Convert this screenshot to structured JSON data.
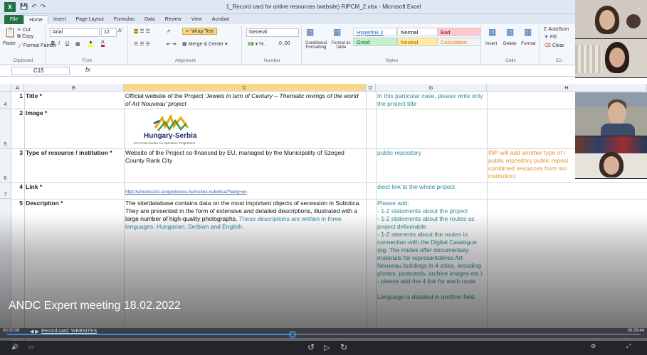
{
  "window": {
    "title": "1_Record card for online resources (website) RIPCM_2.xlsx - Microsoft Excel"
  },
  "ribbon_tabs": [
    "File",
    "Home",
    "Insert",
    "Page Layout",
    "Formulas",
    "Data",
    "Review",
    "View",
    "Acrobat"
  ],
  "ribbon": {
    "clipboard": {
      "paste": "Paste",
      "cut": "Cut",
      "copy": "Copy",
      "format_painter": "Format Painter",
      "label": "Clipboard"
    },
    "font": {
      "name": "Arial",
      "size": "12",
      "label": "Font"
    },
    "alignment": {
      "wrap_text": "Wrap Text",
      "merge_center": "Merge & Center",
      "label": "Alignment"
    },
    "number": {
      "format": "General",
      "label": "Number"
    },
    "styles": {
      "conditional": "Conditional Formatting",
      "format_table": "Format as Table",
      "cells": [
        {
          "name": "Hyperlink 2",
          "bg": "#ffffff",
          "fg": "#2a5db0"
        },
        {
          "name": "Normal",
          "bg": "#ffffff",
          "fg": "#000000"
        },
        {
          "name": "Bad",
          "bg": "#ffc7ce",
          "fg": "#9c0006"
        },
        {
          "name": "Good",
          "bg": "#c6efce",
          "fg": "#006100"
        },
        {
          "name": "Neutral",
          "bg": "#ffeb9c",
          "fg": "#9c6500"
        },
        {
          "name": "Calculation",
          "bg": "#f2f2f2",
          "fg": "#fa7d00"
        }
      ],
      "label": "Styles"
    },
    "cells": {
      "insert": "Insert",
      "delete": "Delete",
      "format": "Format",
      "label": "Cells"
    },
    "editing": {
      "autosum": "AutoSum",
      "fill": "Fill",
      "clear": "Clear",
      "label": "Ed"
    }
  },
  "formula_bar": {
    "cell_ref": "C15",
    "fx": "fx",
    "content": ""
  },
  "columns": [
    "A",
    "B",
    "C",
    "D",
    "G",
    "H"
  ],
  "rows": [
    {
      "num": "4",
      "a": "1",
      "b": "Title *",
      "c_text": "Official website of the Project ",
      "c_italic": "'Jewels in turn of Century – Thematic rovings of the world of Art Nouveau' project",
      "g": "In this particular case, please write only the project title",
      "h": ""
    },
    {
      "num": "5",
      "a": "2",
      "b": "Image *",
      "logo_title": "Hungary-Serbia",
      "logo_sub": "IPA Cross-border Co-operation Programme",
      "g": "",
      "h": ""
    },
    {
      "num": "6",
      "a": "3",
      "b": "Type of resource / institution *",
      "c": "Website of the Project co-financed by EU, managed by the Municipality of Szeged County Rank City",
      "g": "public repository",
      "h": "INP will add another type of r public repository public reposi combined resources from mo institution)"
    },
    {
      "num": "7",
      "a": "4",
      "b": "Link *",
      "c_link": "http://szecesszio.szegedvaros.hu/routes-subotica/?lang=en",
      "g": "diect link to the whole project",
      "h": ""
    },
    {
      "num": "",
      "a": "5",
      "b": "Description *",
      "c_black": "The site/database contains data on the most important objects of secession in Subotica. They are presented in the form of extensive and detailed descriptions, illustrated with a large number of high-quality photographs. ",
      "c_teal": "These descriptions are written in three languages: Hungarian, Serbian and English.",
      "g_lines": [
        "Please add:",
        "- 1-2 statements about the project",
        "- 1-2 statements about the routes as project deliverable",
        "- 1-2 staments about the routes in connection with the Digital Catalogue (eg. The routes offer documentary materials for representatives Art Nouveau buildings in 4 cities, including photos, postcards, archive images etc.)",
        "- please add the 4 link for each route",
        "",
        "Language is detailed in another field."
      ]
    }
  ],
  "video": {
    "meeting_title": "ANDC Expert meeting 18.02.2022",
    "sheet_tab": "Record card_WEBSITES",
    "time_elapsed": "00:00:06",
    "time_total": "00:26:44",
    "progress": 0.45
  },
  "colors": {
    "teal": "#2e8b9a",
    "orange": "#e6912e",
    "selected_col": "#f8d889",
    "progress": "#3d8bd8"
  }
}
